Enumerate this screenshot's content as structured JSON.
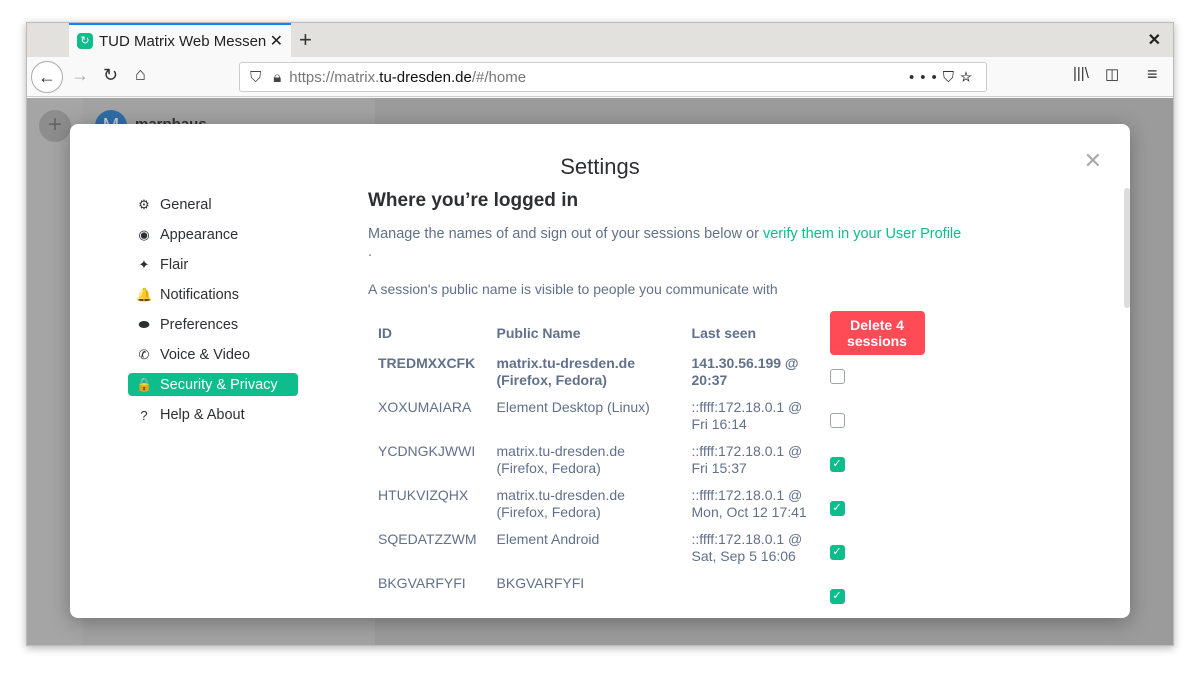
{
  "browser": {
    "tab_title": "TUD Matrix Web Messenger",
    "url_prefix": "https://matrix.",
    "url_domain": "tu-dresden.de",
    "url_path": "/#/home",
    "new_tab": "+",
    "close": "✕",
    "tab_close": "✕"
  },
  "background": {
    "avatar_letter": "M",
    "user_name": "marphaus"
  },
  "settings": {
    "title": "Settings",
    "close": "✕",
    "sidebar": [
      {
        "label": "General",
        "icon": "gear-icon",
        "glyph": "⚙"
      },
      {
        "label": "Appearance",
        "icon": "eye-icon",
        "glyph": "◉"
      },
      {
        "label": "Flair",
        "icon": "sparkle-icon",
        "glyph": "✦"
      },
      {
        "label": "Notifications",
        "icon": "bell-icon",
        "glyph": "🔔"
      },
      {
        "label": "Preferences",
        "icon": "toggle-icon",
        "glyph": "⬬"
      },
      {
        "label": "Voice & Video",
        "icon": "phone-icon",
        "glyph": "✆"
      },
      {
        "label": "Security & Privacy",
        "icon": "lock-icon",
        "glyph": "🔒",
        "active": true
      },
      {
        "label": "Help & About",
        "icon": "help-icon",
        "glyph": "?"
      }
    ],
    "heading": "Where you’re logged in",
    "description": "Manage the names of and sign out of your sessions below or ",
    "verify_link": "verify them in your User Profile",
    "description_end": ".",
    "public_note": "A session's public name is visible to people you communicate with",
    "columns": {
      "id": "ID",
      "name": "Public Name",
      "last_seen": "Last seen"
    },
    "delete_button": "Delete 4 sessions",
    "sessions": [
      {
        "id": "TREDMXXCFK",
        "name": "matrix.tu-dresden.de (Firefox, Fedora)",
        "last_seen": "141.30.56.199 @ 20:37",
        "checked": false,
        "current": true
      },
      {
        "id": "XOXUMAIARA",
        "name": "Element Desktop (Linux)",
        "last_seen": "::ffff:172.18.0.1 @ Fri 16:14",
        "checked": false
      },
      {
        "id": "YCDNGKJWWI",
        "name": "matrix.tu-dresden.de (Firefox, Fedora)",
        "last_seen": "::ffff:172.18.0.1 @ Fri 15:37",
        "checked": true
      },
      {
        "id": "HTUKVIZQHX",
        "name": "matrix.tu-dresden.de (Firefox, Fedora)",
        "last_seen": "::ffff:172.18.0.1 @ Mon, Oct 12 17:41",
        "checked": true
      },
      {
        "id": "SQEDATZZWM",
        "name": "Element Android",
        "last_seen": "::ffff:172.18.0.1 @ Sat, Sep 5 16:06",
        "checked": true
      },
      {
        "id": "BKGVARFYFI",
        "name": "BKGVARFYFI",
        "last_seen": "",
        "checked": true
      }
    ]
  },
  "colors": {
    "accent": "#0dbd8b",
    "danger": "#ff4b55"
  }
}
